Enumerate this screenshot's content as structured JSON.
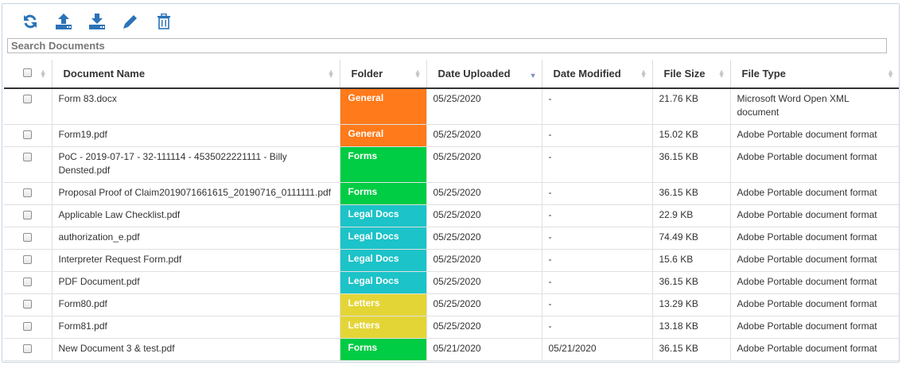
{
  "search": {
    "placeholder": "Search Documents"
  },
  "toolbar": {
    "buttons": [
      {
        "icon": "refresh-icon"
      },
      {
        "icon": "upload-icon"
      },
      {
        "icon": "download-icon"
      },
      {
        "icon": "edit-icon"
      },
      {
        "icon": "trash-icon"
      }
    ],
    "icon_color": "#2a73b8"
  },
  "columns": [
    "Document Name",
    "Folder",
    "Date Uploaded",
    "Date Modified",
    "File Size",
    "File Type"
  ],
  "sorted_column": "Date Uploaded",
  "folder_colors": {
    "General": "#ff7a1a",
    "Forms": "#00cc44",
    "Legal Docs": "#1cc3c8",
    "Letters": "#e4d537"
  },
  "rows": [
    {
      "name": "Form 83.docx",
      "folder": "General",
      "uploaded": "05/25/2020",
      "modified": "-",
      "size": "21.76 KB",
      "type": "Microsoft Word Open XML document"
    },
    {
      "name": "Form19.pdf",
      "folder": "General",
      "uploaded": "05/25/2020",
      "modified": "-",
      "size": "15.02 KB",
      "type": "Adobe Portable document format"
    },
    {
      "name": "PoC - 2019-07-17 - 32-111114 - 4535022221111 - Billy Densted.pdf",
      "folder": "Forms",
      "uploaded": "05/25/2020",
      "modified": "-",
      "size": "36.15 KB",
      "type": "Adobe Portable document format"
    },
    {
      "name": "Proposal Proof of Claim2019071661615_20190716_0111111.pdf",
      "folder": "Forms",
      "uploaded": "05/25/2020",
      "modified": "-",
      "size": "36.15 KB",
      "type": "Adobe Portable document format"
    },
    {
      "name": "Applicable Law Checklist.pdf",
      "folder": "Legal Docs",
      "uploaded": "05/25/2020",
      "modified": "-",
      "size": "22.9 KB",
      "type": "Adobe Portable document format"
    },
    {
      "name": "authorization_e.pdf",
      "folder": "Legal Docs",
      "uploaded": "05/25/2020",
      "modified": "-",
      "size": "74.49 KB",
      "type": "Adobe Portable document format"
    },
    {
      "name": "Interpreter Request Form.pdf",
      "folder": "Legal Docs",
      "uploaded": "05/25/2020",
      "modified": "-",
      "size": "15.6 KB",
      "type": "Adobe Portable document format"
    },
    {
      "name": "PDF Document.pdf",
      "folder": "Legal Docs",
      "uploaded": "05/25/2020",
      "modified": "-",
      "size": "36.15 KB",
      "type": "Adobe Portable document format"
    },
    {
      "name": "Form80.pdf",
      "folder": "Letters",
      "uploaded": "05/25/2020",
      "modified": "-",
      "size": "13.29 KB",
      "type": "Adobe Portable document format"
    },
    {
      "name": "Form81.pdf",
      "folder": "Letters",
      "uploaded": "05/25/2020",
      "modified": "-",
      "size": "13.18 KB",
      "type": "Adobe Portable document format"
    },
    {
      "name": "New Document 3 & test.pdf",
      "folder": "Forms",
      "uploaded": "05/21/2020",
      "modified": "05/21/2020",
      "size": "36.15 KB",
      "type": "Adobe Portable document format"
    }
  ]
}
